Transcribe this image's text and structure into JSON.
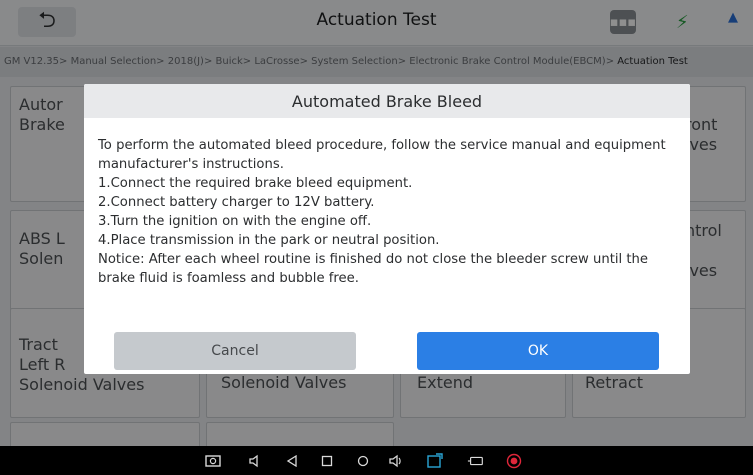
{
  "header": {
    "title": "Actuation Test",
    "back_icon": "back-arrow-icon",
    "message_icon": "message-icon"
  },
  "breadcrumb": {
    "path": "GM V12.35> Manual Selection> 2018(J)> Buick> LaCrosse> System Selection> Electronic Brake Control Module(EBCM)> ",
    "current": "Actuation Test"
  },
  "tiles": [
    {
      "label": "Autor\nBrake"
    },
    {
      "label": "ront\nlves"
    },
    {
      "label": "ABS L\nSolen"
    },
    {
      "label": "ntrol\n\nlves"
    },
    {
      "label": "Tract\nLeft R\nSolenoid Valves"
    },
    {
      "label": "Solenoid Valves"
    },
    {
      "label": "Extend"
    },
    {
      "label": "on\nRetract"
    }
  ],
  "dialog": {
    "title": "Automated Brake Bleed",
    "lines": [
      "To perform the automated bleed procedure, follow the service manual and equipment manufacturer's instructions.",
      "1.Connect the required brake bleed equipment.",
      "2.Connect battery charger to 12V battery.",
      "3.Turn the ignition on with the engine off.",
      "4.Place transmission in the park or neutral position.",
      "Notice: After each wheel routine is finished do not close the bleeder screw until the brake fluid is foamless and bubble free."
    ],
    "cancel_label": "Cancel",
    "ok_label": "OK"
  },
  "colors": {
    "accent": "#2b7fe5",
    "record": "#e0263a"
  },
  "navbar": {
    "icons": [
      "screenshot-icon",
      "volume-down-icon",
      "back-icon",
      "recent-apps-icon",
      "home-icon",
      "volume-up-icon",
      "app-icon",
      "vci-icon",
      "record-icon"
    ]
  }
}
